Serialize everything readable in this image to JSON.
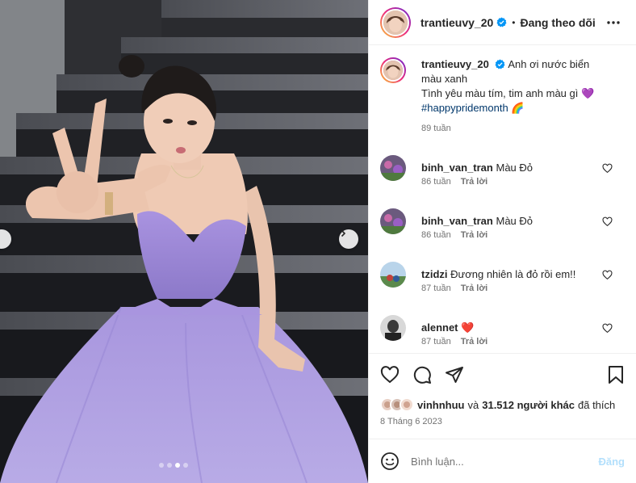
{
  "header": {
    "username": "trantieuvy_20",
    "separator": "•",
    "follow_status": "Đang theo dõi"
  },
  "caption": {
    "username": "trantieuvy_20",
    "line1": "Anh ơi nước biển màu xanh",
    "line2": "Tình yêu màu tím, tim anh màu gì",
    "line2_emoji": "💜",
    "hashtag": "#happypridemonth",
    "hashtag_emoji": "🌈",
    "age": "89 tuần"
  },
  "comments": [
    {
      "username": "binh_van_tran",
      "text": "Màu Đỏ",
      "age": "86 tuần",
      "reply": "Trả lời"
    },
    {
      "username": "binh_van_tran",
      "text": "Màu Đỏ",
      "age": "86 tuần",
      "reply": "Trả lời"
    },
    {
      "username": "tzidzi",
      "text": "Đương nhiên là đỏ rồi em!!",
      "age": "87 tuần",
      "reply": "Trả lời"
    },
    {
      "username": "alennet",
      "text": "❤️",
      "age": "87 tuần",
      "reply": "Trả lời"
    }
  ],
  "likes": {
    "liker": "vinhnhuu",
    "connector": "và",
    "others": "31.512 người khác",
    "suffix": "đã thích"
  },
  "date": "8 Tháng 6 2023",
  "composer": {
    "placeholder": "Bình luận...",
    "post_label": "Đăng"
  },
  "carousel": {
    "total": 4,
    "active_index": 3
  },
  "icons": {
    "emoji": "emoji-icon",
    "like": "heart-icon",
    "comment": "comment-icon",
    "share": "share-icon",
    "save": "bookmark-icon",
    "more": "more-icon",
    "verified": "verified-icon"
  },
  "colors": {
    "verified": "#0095f6",
    "link": "#00376b",
    "muted": "#737373",
    "post_disabled": "#b2dffc",
    "heart_red": "#ed4956"
  }
}
